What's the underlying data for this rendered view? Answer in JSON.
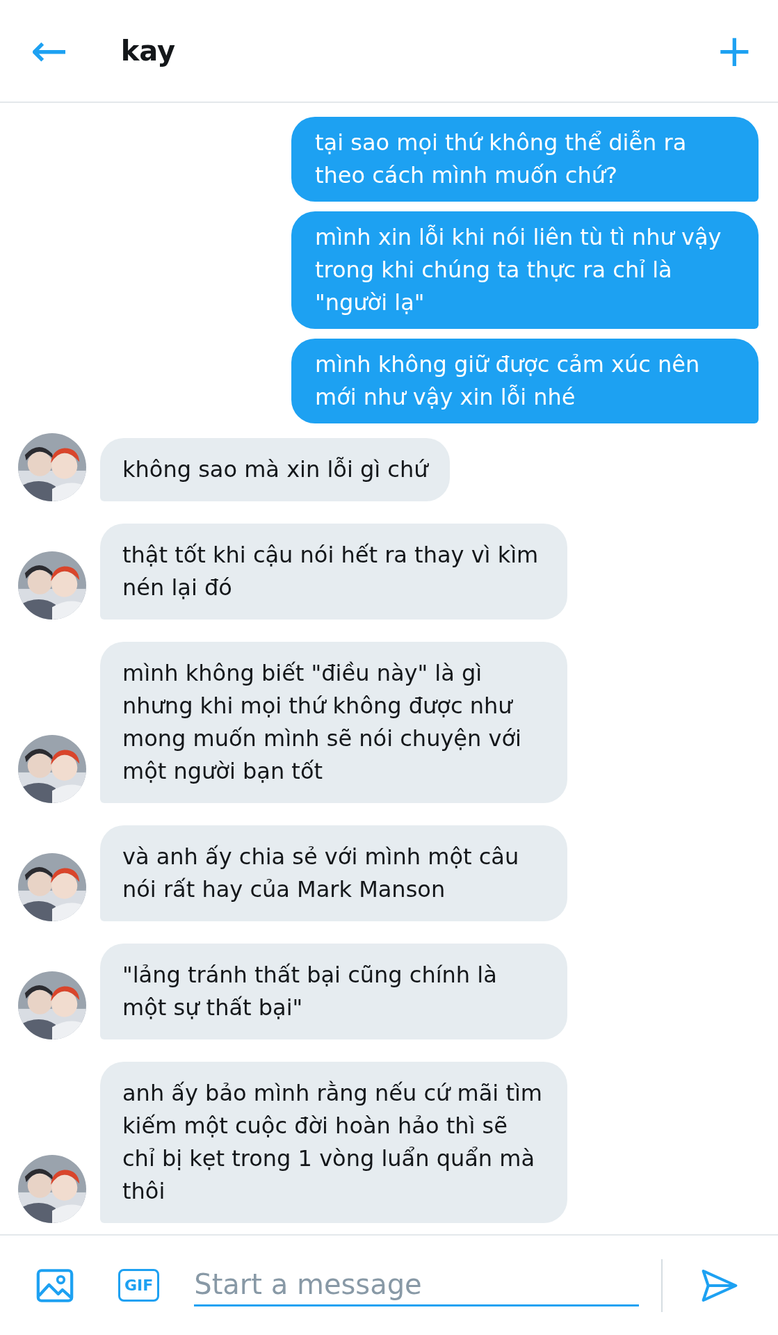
{
  "header": {
    "back": "←",
    "title": "kay",
    "add": "+"
  },
  "messages": [
    {
      "kind": "sent",
      "text": "tại sao mọi thứ không thể diễn ra theo cách mình muốn chứ?"
    },
    {
      "kind": "sent",
      "text": "mình xin lỗi khi nói liên tù tì như vậy trong khi chúng ta thực ra chỉ là \"người lạ\""
    },
    {
      "kind": "sent",
      "text": "mình không giữ được cảm xúc nên mới như vậy xin lỗi nhé"
    },
    {
      "kind": "received",
      "text": "không sao mà xin lỗi gì chứ"
    },
    {
      "kind": "received",
      "text": "thật tốt khi cậu nói hết ra thay vì kìm nén lại đó"
    },
    {
      "kind": "received",
      "text": "mình không biết \"điều này\" là gì nhưng khi mọi thứ không được như mong muốn mình sẽ nói chuyện với một người bạn tốt"
    },
    {
      "kind": "received",
      "text": "và anh ấy chia sẻ với mình một câu nói rất hay của Mark Manson"
    },
    {
      "kind": "received",
      "text": "\"lảng tránh thất bại cũng chính là một sự thất bại\""
    },
    {
      "kind": "received",
      "text": "anh ấy bảo mình rằng nếu cứ mãi tìm kiếm một cuộc đời hoàn hảo thì sẽ chỉ bị kẹt trong 1 vòng luẩn quẩn mà thôi"
    }
  ],
  "composer": {
    "gif": "GIF",
    "placeholder": "Start a message"
  }
}
